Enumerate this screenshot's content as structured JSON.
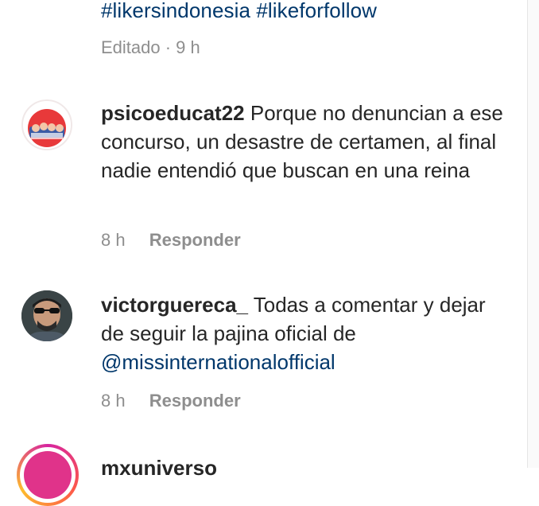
{
  "previous_comment": {
    "hashtags": "#likersindonesia #likeforfollow",
    "meta": "Editado · 9 h"
  },
  "comments": [
    {
      "username": "psicoeducat22",
      "text": " Porque no denuncian a ese concurso, un desastre de certamen, al final nadie entendió que buscan en una reina",
      "time": "8 h",
      "reply_label": "Responder"
    },
    {
      "username": "victorguereca_",
      "text": " Todas a comentar y dejar de seguir la pajina oficial de ",
      "mention": "@missinternationalofficial",
      "time": "8 h",
      "reply_label": "Responder"
    },
    {
      "username": "mxuniverso"
    }
  ]
}
